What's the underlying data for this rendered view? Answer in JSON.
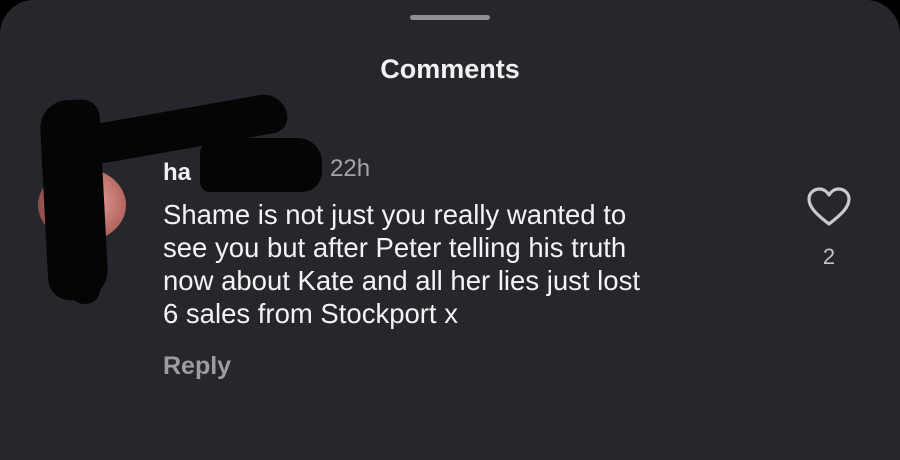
{
  "sheet": {
    "title": "Comments"
  },
  "comment": {
    "author": "ha",
    "timestamp": "22h",
    "text_lines": [
      "Shame is not just you really wanted to",
      "see you but after Peter telling his truth",
      "now about Kate and all her lies just lost",
      "6 sales from Stockport x"
    ],
    "reply_label": "Reply",
    "like_count": "2",
    "like_icon": "heart-outline-icon"
  },
  "colors": {
    "background": "#26272c",
    "primary_text": "#f4f4f4",
    "secondary_text": "#a4a5aa",
    "redaction": "#050505"
  }
}
